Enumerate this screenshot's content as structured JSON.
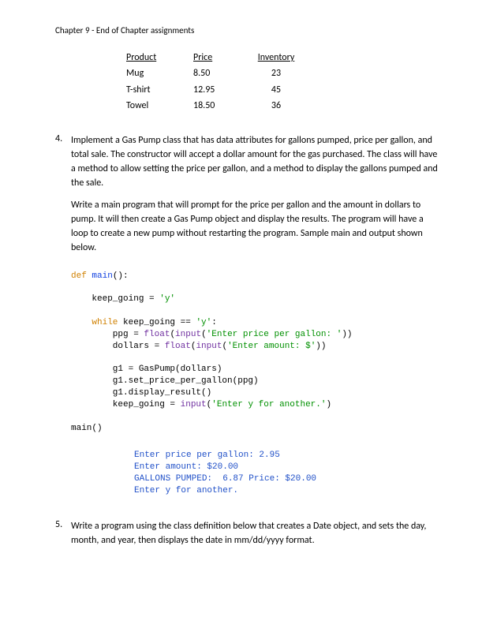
{
  "header": "Chapter 9 - End of Chapter assignments",
  "table": {
    "headers": [
      "Product",
      "Price",
      "Inventory"
    ],
    "rows": [
      [
        "Mug",
        "8.50",
        "23"
      ],
      [
        "T-shirt",
        "12.95",
        "45"
      ],
      [
        "Towel",
        "18.50",
        "36"
      ]
    ]
  },
  "q4": {
    "num": "4.",
    "p1": "Implement a Gas Pump class that has data attributes for gallons pumped, price per gallon, and total sale. The constructor will accept a dollar amount for the gas purchased. The class will have a method to allow setting the price per gallon, and a method to display the gallons pumped and the sale.",
    "p2": "Write a main program that will prompt for the price per gallon and the amount in dollars to pump. It will then create a Gas Pump object and display the results. The program will have a loop to create a new pump without restarting the program. Sample main and output shown below."
  },
  "code": {
    "kw_def": "def",
    "fn_main": "main",
    "l1_tail": "():",
    "l2_a": "    keep_going = ",
    "l2_str": "'y'",
    "kw_while": "while",
    "l3_a": "    ",
    "l3_b": " keep_going == ",
    "l3_str": "'y'",
    "l3_c": ":",
    "l4_a": "        ppg = ",
    "bi_float": "float",
    "bi_input": "input",
    "l4_b": "(",
    "l4_c": "(",
    "l4_str": "'Enter price per gallon: '",
    "l4_d": "))",
    "l5_a": "        dollars = ",
    "l5_b": "(",
    "l5_c": "(",
    "l5_str": "'Enter amount: $'",
    "l5_d": "))",
    "l6": "        g1 = GasPump(dollars)",
    "l7": "        g1.set_price_per_gallon(ppg)",
    "l8": "        g1.display_result()",
    "l9_a": "        keep_going = ",
    "l9_b": "(",
    "l9_str": "'Enter y for another.'",
    "l9_c": ")",
    "l10": "main()"
  },
  "output": "Enter price per gallon: 2.95\nEnter amount: $20.00\nGALLONS PUMPED:  6.87 Price: $20.00\nEnter y for another.",
  "q5": {
    "num": "5.",
    "p1": "Write a program using the class definition below that creates a Date object, and sets the day, month, and year, then displays the date in mm/dd/yyyy format."
  }
}
